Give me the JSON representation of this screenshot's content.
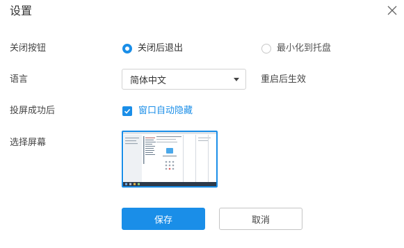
{
  "dialog": {
    "title": "设置"
  },
  "close_behavior": {
    "label": "关闭按钮",
    "options": [
      {
        "label": "关闭后退出",
        "selected": true
      },
      {
        "label": "最小化到托盘",
        "selected": false
      }
    ]
  },
  "language": {
    "label": "语言",
    "selected": "简体中文",
    "note": "重启后生效"
  },
  "after_cast": {
    "label": "投屏成功后",
    "checkbox_label": "窗口自动隐藏",
    "checked": true
  },
  "screen_select": {
    "label": "选择屏幕",
    "selected_index": 0
  },
  "buttons": {
    "save": "保存",
    "cancel": "取消"
  },
  "colors": {
    "accent": "#1a8ee8",
    "text": "#333333",
    "border": "#d2d2d2"
  },
  "icons": {
    "close": "close-icon",
    "dropdown": "chevron-down-icon",
    "check": "check-icon"
  }
}
